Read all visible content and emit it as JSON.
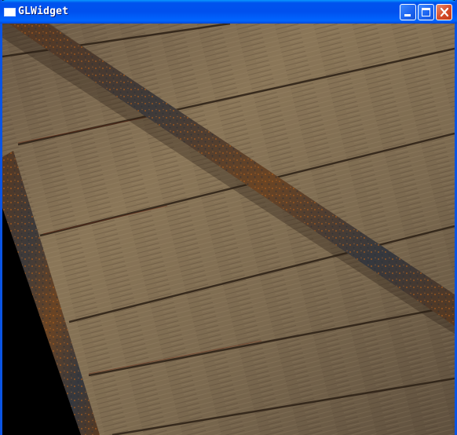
{
  "window": {
    "title": "GLWidget",
    "controls": [
      "minimize",
      "maximize",
      "close"
    ]
  },
  "viewport": {
    "scene": "textured-wood-crate-face",
    "icon_names": [
      "window-app-icon",
      "minimize-icon",
      "maximize-icon",
      "close-icon"
    ]
  }
}
